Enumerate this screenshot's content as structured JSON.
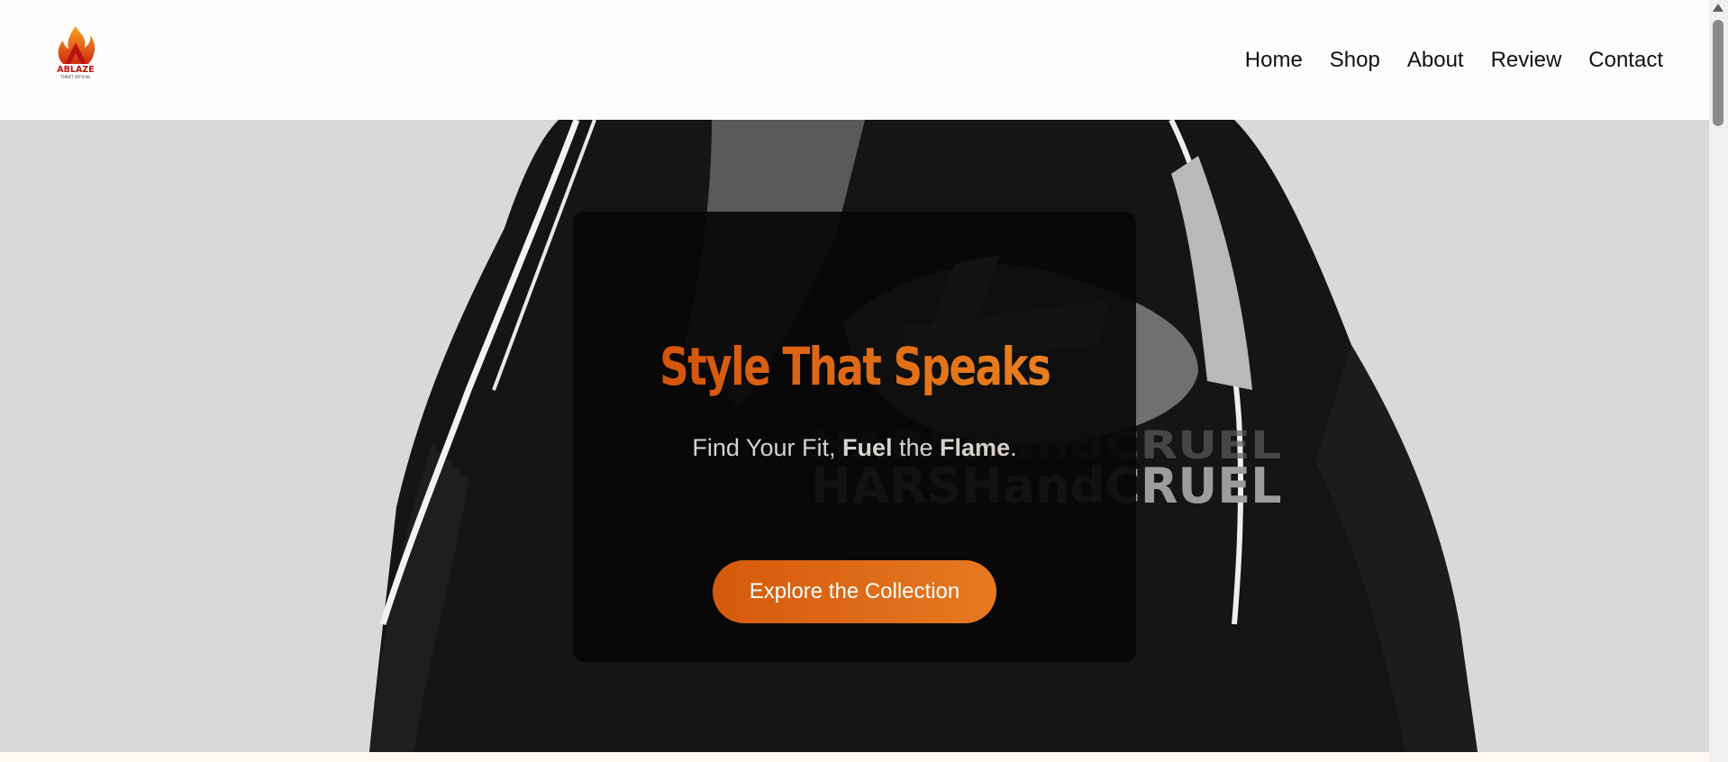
{
  "brand": {
    "logo_text": "ABLAZE",
    "logo_subtext": "THRIFT OFFICIAL"
  },
  "nav": {
    "items": [
      "Home",
      "Shop",
      "About",
      "Review",
      "Contact"
    ]
  },
  "hero": {
    "headline": "Style That Speaks",
    "tagline": {
      "part1": "Find Your Fit, ",
      "bold1": "Fuel",
      "part2": " the ",
      "bold2": "Flame",
      "part3": "."
    },
    "cta_label": "Explore the Collection",
    "graphic_text": "HARSHandCRUEL"
  },
  "colors": {
    "accent": "#d9600f",
    "accent_light": "#e8801f",
    "header_bg": "#fefdfb",
    "hero_bg": "#d8d8d9"
  }
}
